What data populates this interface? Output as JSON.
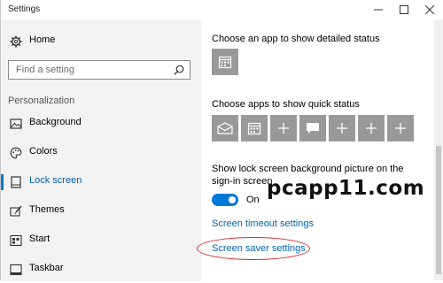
{
  "window": {
    "title": "Settings"
  },
  "sidebar": {
    "home": {
      "label": "Home",
      "icon": "gear-icon"
    },
    "search": {
      "placeholder": "Find a setting",
      "icon": "search-icon"
    },
    "section": "Personalization",
    "items": [
      {
        "label": "Background",
        "icon": "picture-icon",
        "active": false
      },
      {
        "label": "Colors",
        "icon": "palette-icon",
        "active": false
      },
      {
        "label": "Lock screen",
        "icon": "lock-screen-icon",
        "active": true
      },
      {
        "label": "Themes",
        "icon": "brush-icon",
        "active": false
      },
      {
        "label": "Start",
        "icon": "start-grid-icon",
        "active": false
      },
      {
        "label": "Taskbar",
        "icon": "taskbar-icon",
        "active": false
      }
    ]
  },
  "main": {
    "detailed_status_label": "Choose an app to show detailed status",
    "quick_status_label": "Choose apps to show quick status",
    "quick_status_tiles": [
      "mail-icon",
      "calendar-icon",
      "plus-icon",
      "message-icon",
      "plus-icon",
      "plus-icon",
      "plus-icon"
    ],
    "signin_label": "Show lock screen background picture on the sign-in screen",
    "toggle": {
      "state_label": "On",
      "value": true
    },
    "timeout_link": "Screen timeout settings",
    "screensaver_link": "Screen saver settings",
    "watermark": "pcapp11.com"
  },
  "colors": {
    "accent": "#0078d7",
    "link": "#0063b1",
    "tile": "#999999",
    "highlight": "#d9262b"
  }
}
